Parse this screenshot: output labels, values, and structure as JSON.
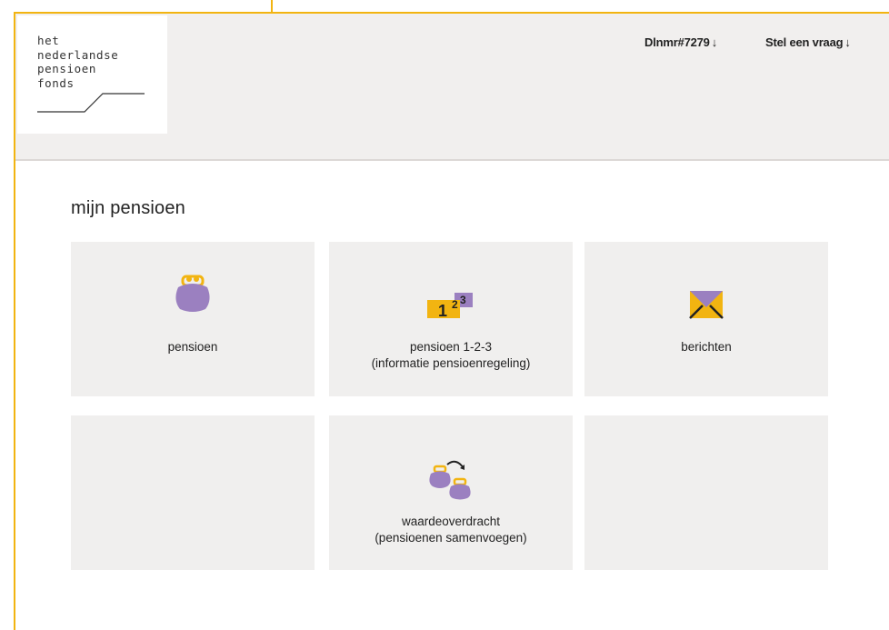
{
  "logo": {
    "lines": [
      "het",
      "nederlandse",
      "pensioen",
      "fonds"
    ]
  },
  "header": {
    "links": [
      {
        "label": "Dlnmr#7279",
        "icon": "arrow-down-icon"
      },
      {
        "label": "Stel een vraag",
        "icon": "arrow-down-icon"
      }
    ]
  },
  "page": {
    "title": "mijn pensioen"
  },
  "tiles": [
    {
      "icon": "purse-icon",
      "label_line1": "pensioen",
      "label_line2": ""
    },
    {
      "icon": "numbers-123-icon",
      "label_line1": "pensioen 1-2-3",
      "label_line2": "(informatie pensioenregeling)"
    },
    {
      "icon": "envelope-icon",
      "label_line1": "berichten",
      "label_line2": ""
    },
    {
      "icon": "",
      "label_line1": "",
      "label_line2": ""
    },
    {
      "icon": "transfer-purses-icon",
      "label_line1": "waardeoverdracht",
      "label_line2": "(pensioenen samenvoegen)"
    },
    {
      "icon": "",
      "label_line1": "",
      "label_line2": ""
    }
  ],
  "icon_text": {
    "numbers": {
      "one": "1",
      "two": "2",
      "three": "3"
    }
  },
  "colors": {
    "accent_yellow": "#f2b411",
    "purple": "#9b80c0",
    "tile_bg": "#f0efee",
    "header_bg": "#f1efee"
  }
}
